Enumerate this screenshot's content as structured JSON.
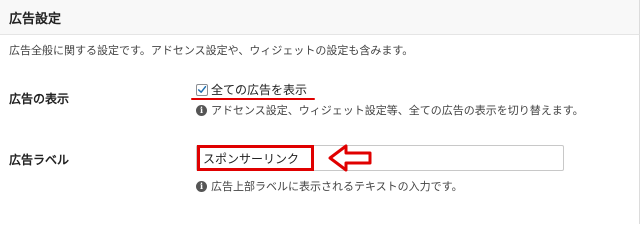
{
  "panel": {
    "title": "広告設定",
    "description": "広告全般に関する設定です。アドセンス設定や、ウィジェットの設定も含みます。"
  },
  "show_ads": {
    "label": "広告の表示",
    "checkbox_label": "全ての広告を表示",
    "checked": true,
    "help": "アドセンス設定、ウィジェット設定等、全ての広告の表示を切り替えます。"
  },
  "ad_label": {
    "label": "広告ラベル",
    "value": "スポンサーリンク",
    "help": "広告上部ラベルに表示されるテキストの入力です。"
  },
  "icons": {
    "info": "info-icon",
    "check": "checkmark-icon",
    "arrow": "left-arrow-icon"
  },
  "colors": {
    "annotation": "#e00000",
    "checkmark": "#2271b1"
  }
}
